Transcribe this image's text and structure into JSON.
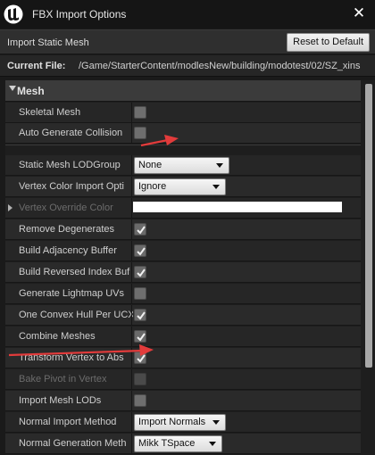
{
  "window": {
    "title": "FBX Import Options",
    "close_glyph": "✕"
  },
  "header": {
    "label": "Import Static Mesh",
    "reset_label": "Reset to Default"
  },
  "file": {
    "label": "Current File:",
    "path": "/Game/StarterContent/modlesNew/building/modotest/02/SZ_xins"
  },
  "section": {
    "title": "Mesh"
  },
  "rows": [
    {
      "label": "Skeletal Mesh",
      "type": "checkbox",
      "checked": false
    },
    {
      "label": "Auto Generate Collision",
      "type": "checkbox",
      "checked": false
    },
    {
      "label": "Static Mesh LODGroup",
      "type": "combo",
      "value": "None"
    },
    {
      "label": "Vertex Color Import Opti",
      "type": "combo",
      "value": "Ignore"
    },
    {
      "label": "Vertex Override Color",
      "type": "color",
      "disabled": true
    },
    {
      "label": "Remove Degenerates",
      "type": "checkbox",
      "checked": true
    },
    {
      "label": "Build Adjacency Buffer",
      "type": "checkbox",
      "checked": true
    },
    {
      "label": "Build Reversed Index Buf",
      "type": "checkbox",
      "checked": true
    },
    {
      "label": "Generate Lightmap UVs",
      "type": "checkbox",
      "checked": false
    },
    {
      "label": "One Convex Hull Per UCX",
      "type": "checkbox",
      "checked": true
    },
    {
      "label": "Combine Meshes",
      "type": "checkbox",
      "checked": true
    },
    {
      "label": "Transform Vertex to Abs",
      "type": "checkbox",
      "checked": true
    },
    {
      "label": "Bake Pivot in Vertex",
      "type": "checkbox",
      "checked": false,
      "disabled": true
    },
    {
      "label": "Import Mesh LODs",
      "type": "checkbox",
      "checked": false
    },
    {
      "label": "Normal Import Method",
      "type": "combo",
      "value": "Import Normals"
    },
    {
      "label": "Normal Generation Meth",
      "type": "combo",
      "value": "Mikk TSpace"
    }
  ],
  "colors": {
    "annotation_arrow": "#e23b3b",
    "panel_bg": "#262626",
    "accent_white": "#ffffff"
  }
}
